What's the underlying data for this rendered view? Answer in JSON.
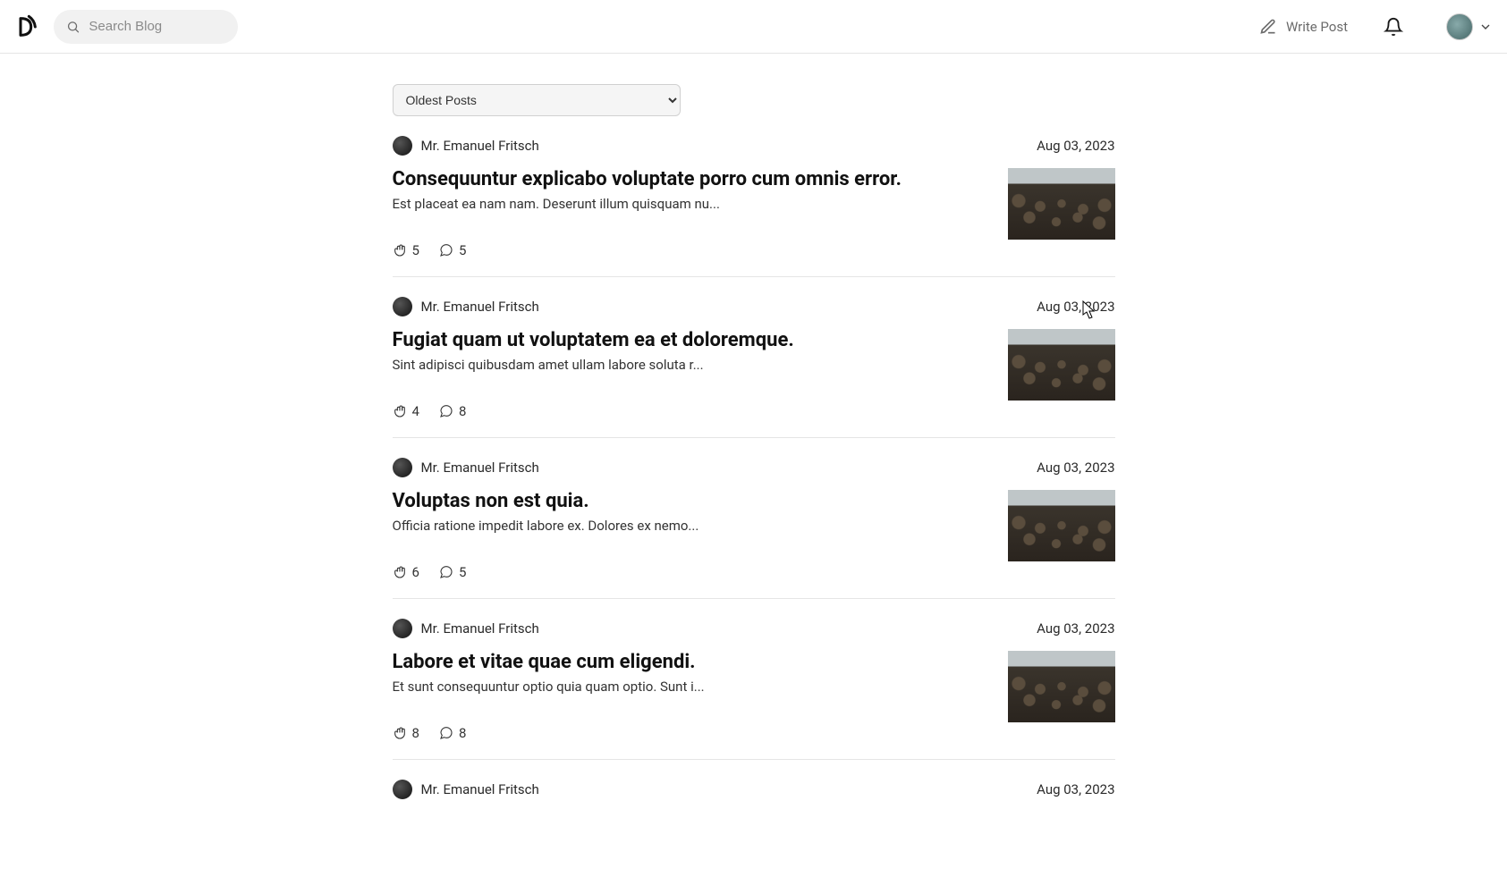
{
  "header": {
    "search_placeholder": "Search Blog",
    "write_post_label": "Write Post"
  },
  "sort": {
    "selected": "Oldest Posts"
  },
  "posts": [
    {
      "author": "Mr. Emanuel Fritsch",
      "date": "Aug 03, 2023",
      "title": "Consequuntur explicabo voluptate porro cum omnis error.",
      "excerpt": "Est placeat ea nam nam. Deserunt illum quisquam nu...",
      "claps": "5",
      "comments": "5"
    },
    {
      "author": "Mr. Emanuel Fritsch",
      "date": "Aug 03, 2023",
      "title": "Fugiat quam ut voluptatem ea et doloremque.",
      "excerpt": "Sint adipisci quibusdam amet ullam labore soluta r...",
      "claps": "4",
      "comments": "8"
    },
    {
      "author": "Mr. Emanuel Fritsch",
      "date": "Aug 03, 2023",
      "title": "Voluptas non est quia.",
      "excerpt": "Officia ratione impedit labore ex. Dolores ex nemo...",
      "claps": "6",
      "comments": "5"
    },
    {
      "author": "Mr. Emanuel Fritsch",
      "date": "Aug 03, 2023",
      "title": "Labore et vitae quae cum eligendi.",
      "excerpt": "Et sunt consequuntur optio quia quam optio. Sunt i...",
      "claps": "8",
      "comments": "8"
    },
    {
      "author": "Mr. Emanuel Fritsch",
      "date": "Aug 03, 2023",
      "title": "",
      "excerpt": "",
      "claps": "",
      "comments": ""
    }
  ]
}
